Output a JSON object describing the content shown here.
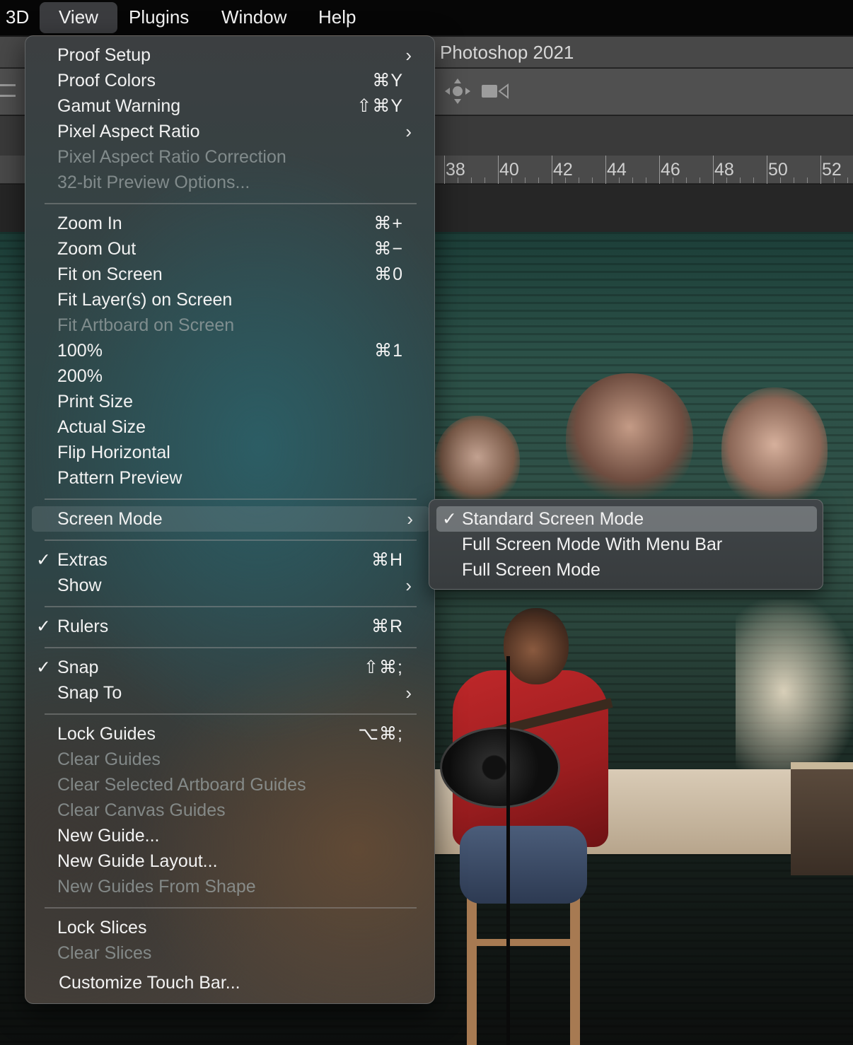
{
  "menubar": {
    "items": [
      "3D",
      "View",
      "Plugins",
      "Window",
      "Help"
    ],
    "active": "View"
  },
  "document": {
    "title": "Photoshop 2021"
  },
  "ruler": {
    "labels": [
      "38",
      "40",
      "42",
      "44",
      "46",
      "48",
      "50",
      "52"
    ]
  },
  "view_menu": {
    "proof_setup": {
      "label": "Proof Setup",
      "submenu": true
    },
    "proof_colors": {
      "label": "Proof Colors",
      "shortcut": "⌘Y"
    },
    "gamut_warning": {
      "label": "Gamut Warning",
      "shortcut": "⇧⌘Y"
    },
    "pixel_aspect_ratio": {
      "label": "Pixel Aspect Ratio",
      "submenu": true
    },
    "pixel_aspect_ratio_correction": {
      "label": "Pixel Aspect Ratio Correction",
      "enabled": false
    },
    "preview_32bit": {
      "label": "32-bit Preview Options...",
      "enabled": false
    },
    "zoom_in": {
      "label": "Zoom In",
      "shortcut": "⌘+"
    },
    "zoom_out": {
      "label": "Zoom Out",
      "shortcut": "⌘−"
    },
    "fit_on_screen": {
      "label": "Fit on Screen",
      "shortcut": "⌘0"
    },
    "fit_layers": {
      "label": "Fit Layer(s) on Screen"
    },
    "fit_artboard": {
      "label": "Fit Artboard on Screen",
      "enabled": false
    },
    "zoom_100": {
      "label": "100%",
      "shortcut": "⌘1"
    },
    "zoom_200": {
      "label": "200%"
    },
    "print_size": {
      "label": "Print Size"
    },
    "actual_size": {
      "label": "Actual Size"
    },
    "flip_horizontal": {
      "label": "Flip Horizontal"
    },
    "pattern_preview": {
      "label": "Pattern Preview"
    },
    "screen_mode": {
      "label": "Screen Mode",
      "submenu": true,
      "open": true
    },
    "extras": {
      "label": "Extras",
      "shortcut": "⌘H",
      "checked": true
    },
    "show": {
      "label": "Show",
      "submenu": true
    },
    "rulers": {
      "label": "Rulers",
      "shortcut": "⌘R",
      "checked": true
    },
    "snap": {
      "label": "Snap",
      "shortcut": "⇧⌘;",
      "checked": true
    },
    "snap_to": {
      "label": "Snap To",
      "submenu": true
    },
    "lock_guides": {
      "label": "Lock Guides",
      "shortcut": "⌥⌘;"
    },
    "clear_guides": {
      "label": "Clear Guides",
      "enabled": false
    },
    "clear_selected_artboard_guides": {
      "label": "Clear Selected Artboard Guides",
      "enabled": false
    },
    "clear_canvas_guides": {
      "label": "Clear Canvas Guides",
      "enabled": false
    },
    "new_guide": {
      "label": "New Guide..."
    },
    "new_guide_layout": {
      "label": "New Guide Layout..."
    },
    "new_guides_from_shape": {
      "label": "New Guides From Shape",
      "enabled": false
    },
    "lock_slices": {
      "label": "Lock Slices"
    },
    "clear_slices": {
      "label": "Clear Slices",
      "enabled": false
    },
    "customize_touch_bar": {
      "label": "Customize Touch Bar..."
    }
  },
  "screen_mode_submenu": {
    "standard": {
      "label": "Standard Screen Mode",
      "checked": true
    },
    "full_with_menu_bar": {
      "label": "Full Screen Mode With Menu Bar"
    },
    "full": {
      "label": "Full Screen Mode"
    }
  },
  "glyphs": {
    "check": "✓",
    "chevron": "›"
  },
  "colors": {
    "menubar": "#060606",
    "menu_text": "#f2f2f2",
    "disabled_text": "#9aa3a3",
    "shirt_red": "#c0282a"
  }
}
